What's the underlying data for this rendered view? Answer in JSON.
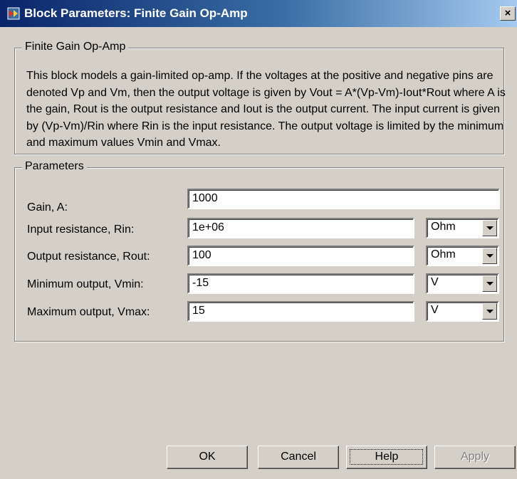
{
  "window": {
    "title": "Block Parameters: Finite Gain Op-Amp",
    "close_glyph": "×"
  },
  "description": {
    "legend": "Finite Gain Op-Amp",
    "text": "This block models a gain-limited op-amp. If the voltages at the positive and negative pins are denoted Vp and Vm, then the output voltage is given by Vout = A*(Vp-Vm)-Iout*Rout where A is the gain, Rout is the output resistance and Iout is the output current. The input current is given by (Vp-Vm)/Rin where Rin is the input resistance. The output voltage is limited by the minimum and maximum values Vmin and Vmax."
  },
  "parameters": {
    "legend": "Parameters",
    "gain": {
      "label": "Gain, A:",
      "value": "1000"
    },
    "rin": {
      "label": "Input resistance, Rin:",
      "value": "1e+06",
      "unit": "Ohm"
    },
    "rout": {
      "label": "Output resistance, Rout:",
      "value": "100",
      "unit": "Ohm"
    },
    "vmin": {
      "label": "Minimum output, Vmin:",
      "value": "-15",
      "unit": "V"
    },
    "vmax": {
      "label": "Maximum output, Vmax:",
      "value": "15",
      "unit": "V"
    }
  },
  "buttons": {
    "ok": "OK",
    "cancel": "Cancel",
    "help": "Help",
    "apply": "Apply"
  },
  "icons": {
    "title_icon": "simulink-block-icon",
    "dropdown_icon": "chevron-down-icon"
  }
}
